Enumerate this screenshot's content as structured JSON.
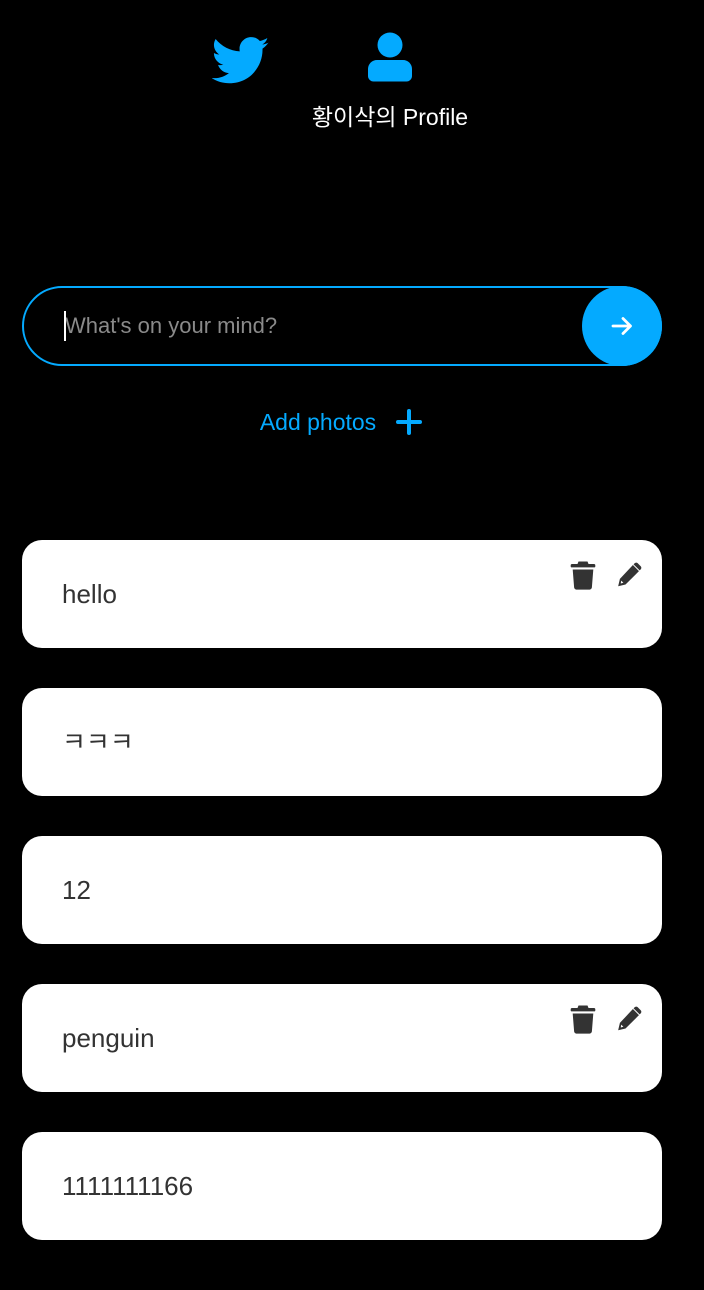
{
  "nav": {
    "home_icon": "twitter-bird-icon",
    "profile_icon": "user-icon",
    "profile_label": "황이삭의 Profile"
  },
  "composer": {
    "placeholder": "What's on your mind?",
    "value": "",
    "submit_icon": "arrow-right-icon"
  },
  "add_photos": {
    "label": "Add photos",
    "icon": "plus-icon"
  },
  "tweets": [
    {
      "text": "hello",
      "owned": true
    },
    {
      "text": "ㅋㅋㅋ",
      "owned": false
    },
    {
      "text": "12",
      "owned": false
    },
    {
      "text": "penguin",
      "owned": true
    },
    {
      "text": "1111111166",
      "owned": false
    }
  ],
  "colors": {
    "accent": "#04aaff",
    "background": "#000000",
    "card": "#ffffff",
    "card_text": "#333333"
  }
}
